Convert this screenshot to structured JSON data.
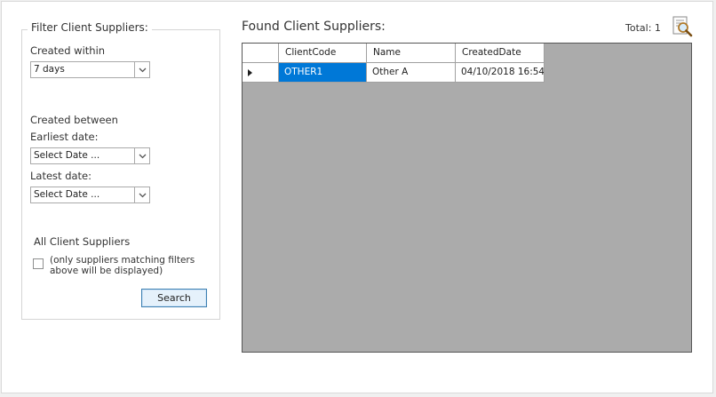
{
  "filter": {
    "title": "Filter Client Suppliers:",
    "created_within_label": "Created within",
    "created_within_value": "7 days",
    "created_between_label": "Created between",
    "earliest_label": "Earliest date:",
    "earliest_value": "Select Date ...",
    "latest_label": "Latest date:",
    "latest_value": "Select Date ...",
    "all_label": "All Client Suppliers",
    "all_checked": false,
    "all_note_line1": "(only suppliers matching filters",
    "all_note_line2": "above will be displayed)",
    "search_label": "Search"
  },
  "results": {
    "title": "Found Client Suppliers:",
    "total_text": "Total: 1",
    "icon": "magnifier-document-icon",
    "columns": [
      "ClientCode",
      "Name",
      "CreatedDate"
    ],
    "rows": [
      {
        "ClientCode": "OTHER1",
        "Name": "Other A",
        "CreatedDate": "04/10/2018 16:54"
      }
    ]
  },
  "colors": {
    "selection": "#0078d7",
    "grid_background": "#ababab",
    "button_border": "#3c7fb1"
  }
}
